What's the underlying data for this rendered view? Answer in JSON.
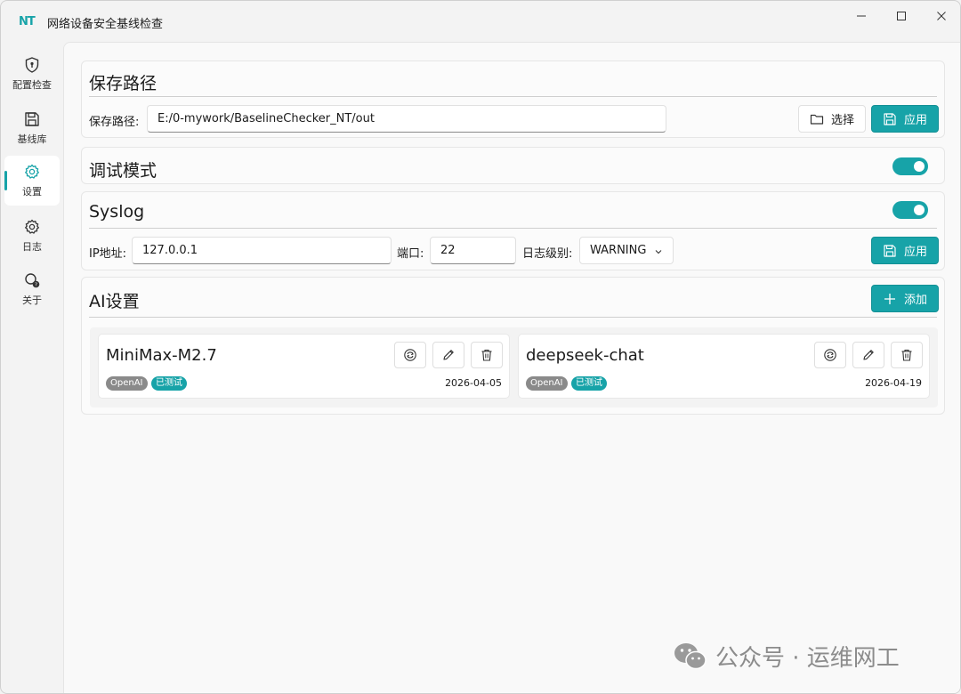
{
  "window": {
    "logo_text": "NT",
    "title": "网络设备安全基线检查"
  },
  "sidebar": {
    "items": [
      {
        "label": "配置检查",
        "icon": "shield-icon"
      },
      {
        "label": "基线库",
        "icon": "save-icon"
      },
      {
        "label": "设置",
        "icon": "gear-icon",
        "active": true
      },
      {
        "label": "日志",
        "icon": "gear-icon"
      },
      {
        "label": "关于",
        "icon": "help-icon"
      }
    ]
  },
  "save_path": {
    "title": "保存路径",
    "label": "保存路径:",
    "value": "E:/0-mywork/BaselineChecker_NT/out",
    "select_label": "选择",
    "apply_label": "应用"
  },
  "debug": {
    "title": "调试模式",
    "enabled": true
  },
  "syslog": {
    "title": "Syslog",
    "enabled": true,
    "ip_label": "IP地址:",
    "ip_value": "127.0.0.1",
    "port_label": "端口:",
    "port_value": "22",
    "level_label": "日志级别:",
    "level_value": "WARNING",
    "apply_label": "应用"
  },
  "ai": {
    "title": "AI设置",
    "add_label": "添加",
    "models": [
      {
        "name": "MiniMax-M2.7",
        "provider": "OpenAI",
        "status": "已测试",
        "date": "2026-04-05"
      },
      {
        "name": "deepseek-chat",
        "provider": "OpenAI",
        "status": "已测试",
        "date": "2026-04-19"
      }
    ]
  },
  "watermark": {
    "text": "公众号 · 运维网工"
  },
  "colors": {
    "accent": "#17a3a8",
    "tag_gray": "#8a8a8a"
  }
}
